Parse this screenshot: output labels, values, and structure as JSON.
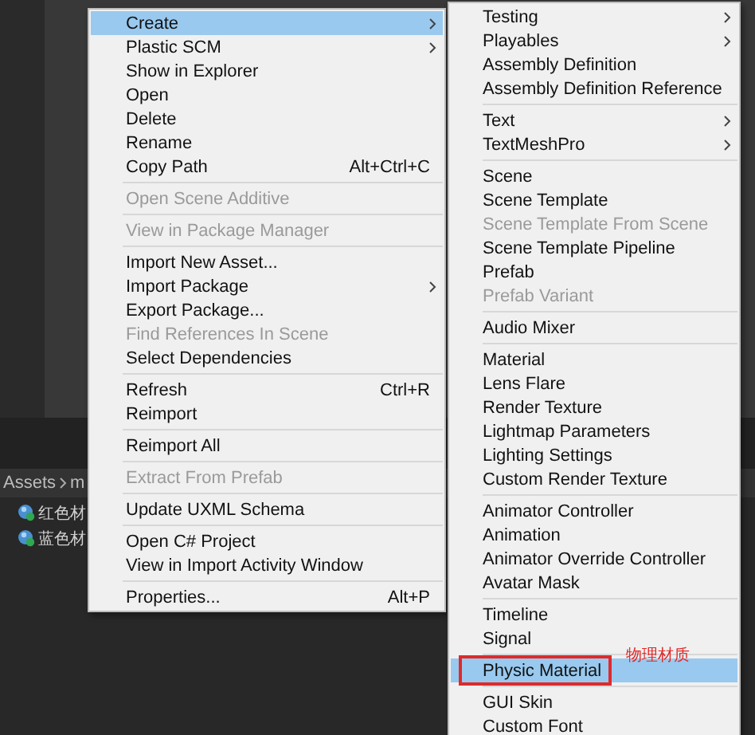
{
  "project": {
    "breadcrumb": [
      "Assets",
      "m"
    ],
    "assets": [
      {
        "name": "红色材"
      },
      {
        "name": "蓝色材"
      }
    ]
  },
  "main_menu": {
    "items": [
      {
        "kind": "item",
        "label": "Create",
        "selected": true,
        "disabled": false,
        "has_submenu": true
      },
      {
        "kind": "item",
        "label": "Plastic SCM",
        "selected": false,
        "disabled": false,
        "has_submenu": true
      },
      {
        "kind": "item",
        "label": "Show in Explorer",
        "selected": false,
        "disabled": false,
        "has_submenu": false
      },
      {
        "kind": "item",
        "label": "Open",
        "selected": false,
        "disabled": false,
        "has_submenu": false
      },
      {
        "kind": "item",
        "label": "Delete",
        "selected": false,
        "disabled": false,
        "has_submenu": false
      },
      {
        "kind": "item",
        "label": "Rename",
        "selected": false,
        "disabled": false,
        "has_submenu": false
      },
      {
        "kind": "item",
        "label": "Copy Path",
        "shortcut": "Alt+Ctrl+C",
        "selected": false,
        "disabled": false,
        "has_submenu": false
      },
      {
        "kind": "separator"
      },
      {
        "kind": "item",
        "label": "Open Scene Additive",
        "selected": false,
        "disabled": true,
        "has_submenu": false
      },
      {
        "kind": "separator"
      },
      {
        "kind": "item",
        "label": "View in Package Manager",
        "selected": false,
        "disabled": true,
        "has_submenu": false
      },
      {
        "kind": "separator"
      },
      {
        "kind": "item",
        "label": "Import New Asset...",
        "selected": false,
        "disabled": false,
        "has_submenu": false
      },
      {
        "kind": "item",
        "label": "Import Package",
        "selected": false,
        "disabled": false,
        "has_submenu": true
      },
      {
        "kind": "item",
        "label": "Export Package...",
        "selected": false,
        "disabled": false,
        "has_submenu": false
      },
      {
        "kind": "item",
        "label": "Find References In Scene",
        "selected": false,
        "disabled": true,
        "has_submenu": false
      },
      {
        "kind": "item",
        "label": "Select Dependencies",
        "selected": false,
        "disabled": false,
        "has_submenu": false
      },
      {
        "kind": "separator"
      },
      {
        "kind": "item",
        "label": "Refresh",
        "shortcut": "Ctrl+R",
        "selected": false,
        "disabled": false,
        "has_submenu": false
      },
      {
        "kind": "item",
        "label": "Reimport",
        "selected": false,
        "disabled": false,
        "has_submenu": false
      },
      {
        "kind": "separator"
      },
      {
        "kind": "item",
        "label": "Reimport All",
        "selected": false,
        "disabled": false,
        "has_submenu": false
      },
      {
        "kind": "separator"
      },
      {
        "kind": "item",
        "label": "Extract From Prefab",
        "selected": false,
        "disabled": true,
        "has_submenu": false
      },
      {
        "kind": "separator"
      },
      {
        "kind": "item",
        "label": "Update UXML Schema",
        "selected": false,
        "disabled": false,
        "has_submenu": false
      },
      {
        "kind": "separator"
      },
      {
        "kind": "item",
        "label": "Open C# Project",
        "selected": false,
        "disabled": false,
        "has_submenu": false
      },
      {
        "kind": "item",
        "label": "View in Import Activity Window",
        "selected": false,
        "disabled": false,
        "has_submenu": false
      },
      {
        "kind": "separator"
      },
      {
        "kind": "item",
        "label": "Properties...",
        "shortcut": "Alt+P",
        "selected": false,
        "disabled": false,
        "has_submenu": false
      }
    ]
  },
  "create_submenu": {
    "annotation": "物理材质",
    "items": [
      {
        "kind": "item",
        "label": "Testing",
        "selected": false,
        "disabled": false,
        "has_submenu": true,
        "outlined": false
      },
      {
        "kind": "item",
        "label": "Playables",
        "selected": false,
        "disabled": false,
        "has_submenu": true,
        "outlined": false
      },
      {
        "kind": "item",
        "label": "Assembly Definition",
        "selected": false,
        "disabled": false,
        "has_submenu": false,
        "outlined": false
      },
      {
        "kind": "item",
        "label": "Assembly Definition Reference",
        "selected": false,
        "disabled": false,
        "has_submenu": false,
        "outlined": false
      },
      {
        "kind": "separator"
      },
      {
        "kind": "item",
        "label": "Text",
        "selected": false,
        "disabled": false,
        "has_submenu": true,
        "outlined": false
      },
      {
        "kind": "item",
        "label": "TextMeshPro",
        "selected": false,
        "disabled": false,
        "has_submenu": true,
        "outlined": false
      },
      {
        "kind": "separator"
      },
      {
        "kind": "item",
        "label": "Scene",
        "selected": false,
        "disabled": false,
        "has_submenu": false,
        "outlined": false
      },
      {
        "kind": "item",
        "label": "Scene Template",
        "selected": false,
        "disabled": false,
        "has_submenu": false,
        "outlined": false
      },
      {
        "kind": "item",
        "label": "Scene Template From Scene",
        "selected": false,
        "disabled": true,
        "has_submenu": false,
        "outlined": false
      },
      {
        "kind": "item",
        "label": "Scene Template Pipeline",
        "selected": false,
        "disabled": false,
        "has_submenu": false,
        "outlined": false
      },
      {
        "kind": "item",
        "label": "Prefab",
        "selected": false,
        "disabled": false,
        "has_submenu": false,
        "outlined": false
      },
      {
        "kind": "item",
        "label": "Prefab Variant",
        "selected": false,
        "disabled": true,
        "has_submenu": false,
        "outlined": false
      },
      {
        "kind": "separator"
      },
      {
        "kind": "item",
        "label": "Audio Mixer",
        "selected": false,
        "disabled": false,
        "has_submenu": false,
        "outlined": false
      },
      {
        "kind": "separator"
      },
      {
        "kind": "item",
        "label": "Material",
        "selected": false,
        "disabled": false,
        "has_submenu": false,
        "outlined": false
      },
      {
        "kind": "item",
        "label": "Lens Flare",
        "selected": false,
        "disabled": false,
        "has_submenu": false,
        "outlined": false
      },
      {
        "kind": "item",
        "label": "Render Texture",
        "selected": false,
        "disabled": false,
        "has_submenu": false,
        "outlined": false
      },
      {
        "kind": "item",
        "label": "Lightmap Parameters",
        "selected": false,
        "disabled": false,
        "has_submenu": false,
        "outlined": false
      },
      {
        "kind": "item",
        "label": "Lighting Settings",
        "selected": false,
        "disabled": false,
        "has_submenu": false,
        "outlined": false
      },
      {
        "kind": "item",
        "label": "Custom Render Texture",
        "selected": false,
        "disabled": false,
        "has_submenu": false,
        "outlined": false
      },
      {
        "kind": "separator"
      },
      {
        "kind": "item",
        "label": "Animator Controller",
        "selected": false,
        "disabled": false,
        "has_submenu": false,
        "outlined": false
      },
      {
        "kind": "item",
        "label": "Animation",
        "selected": false,
        "disabled": false,
        "has_submenu": false,
        "outlined": false
      },
      {
        "kind": "item",
        "label": "Animator Override Controller",
        "selected": false,
        "disabled": false,
        "has_submenu": false,
        "outlined": false
      },
      {
        "kind": "item",
        "label": "Avatar Mask",
        "selected": false,
        "disabled": false,
        "has_submenu": false,
        "outlined": false
      },
      {
        "kind": "separator"
      },
      {
        "kind": "item",
        "label": "Timeline",
        "selected": false,
        "disabled": false,
        "has_submenu": false,
        "outlined": false
      },
      {
        "kind": "item",
        "label": "Signal",
        "selected": false,
        "disabled": false,
        "has_submenu": false,
        "outlined": false
      },
      {
        "kind": "separator"
      },
      {
        "kind": "item",
        "label": "Physic Material",
        "selected": true,
        "disabled": false,
        "has_submenu": false,
        "outlined": true
      },
      {
        "kind": "separator"
      },
      {
        "kind": "item",
        "label": "GUI Skin",
        "selected": false,
        "disabled": false,
        "has_submenu": false,
        "outlined": false
      },
      {
        "kind": "item",
        "label": "Custom Font",
        "selected": false,
        "disabled": false,
        "has_submenu": false,
        "outlined": false
      }
    ]
  }
}
